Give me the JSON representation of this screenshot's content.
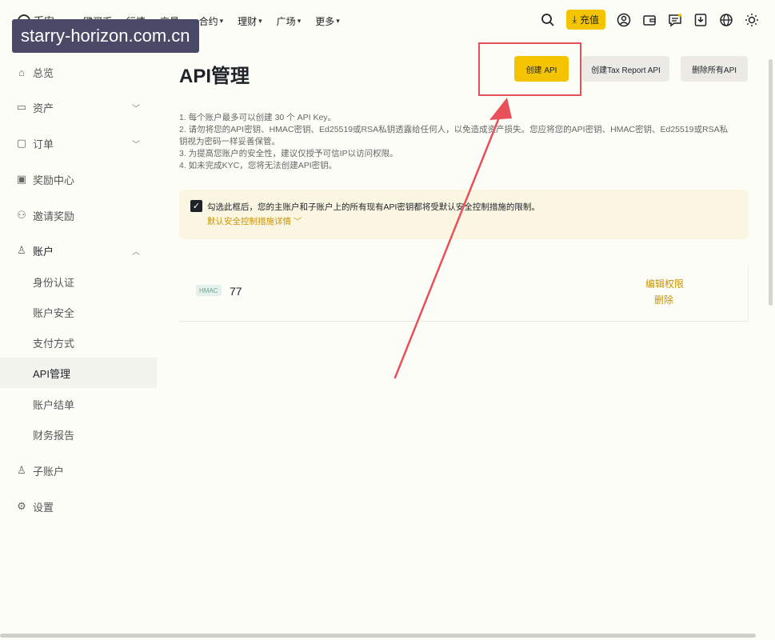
{
  "watermark": "starry-horizon.com.cn",
  "nav": {
    "logo": "币安",
    "items": [
      {
        "label": "一键买币",
        "caret": false
      },
      {
        "label": "行情",
        "caret": false
      },
      {
        "label": "交易",
        "caret": true
      },
      {
        "label": "合约",
        "caret": true
      },
      {
        "label": "理财",
        "caret": true
      },
      {
        "label": "广场",
        "caret": true
      },
      {
        "label": "更多",
        "caret": true
      }
    ],
    "deposit_label": "充值"
  },
  "sidebar": {
    "items": [
      {
        "label": "总览",
        "icon": "home-icon"
      },
      {
        "label": "资产",
        "icon": "wallet-icon"
      },
      {
        "label": "订单",
        "icon": "order-icon"
      },
      {
        "label": "奖励中心",
        "icon": "reward-icon"
      },
      {
        "label": "邀请奖励",
        "icon": "invite-icon"
      },
      {
        "label": "账户",
        "icon": "user-icon"
      },
      {
        "label": "子账户",
        "icon": "sub-account-icon"
      },
      {
        "label": "设置",
        "icon": "settings-icon"
      }
    ],
    "account_sub": [
      "身份认证",
      "账户安全",
      "支付方式",
      "API管理",
      "账户结单",
      "财务报告"
    ]
  },
  "main": {
    "title": "API管理",
    "create_api": "创建 API",
    "create_tax": "创建Tax Report API",
    "delete_all": "删除所有API",
    "notes": [
      "1. 每个账户最多可以创建 30 个 API Key。",
      "2. 请勿将您的API密钥、HMAC密钥、Ed25519或RSA私钥透露给任何人，以免造成资产损失。您应将您的API密钥、HMAC密钥、Ed25519或RSA私",
      "钥视为密码一样妥善保管。",
      "3. 为提高您账户的安全性，建议仅授予可信IP以访问权限。",
      "4. 如未完成KYC，您将无法创建API密钥。"
    ],
    "warning_text": "勾选此框后，您的主账户和子账户上的所有现有API密钥都将受默认安全控制措施的限制。",
    "warning_link": "默认安全控制措施详情",
    "key": {
      "badge": "HMAC",
      "name": "77",
      "edit": "编辑权限",
      "remove": "删除"
    }
  },
  "colors": {
    "accent": "#f5c400",
    "link": "#c99400",
    "annotation": "#e8505a"
  }
}
